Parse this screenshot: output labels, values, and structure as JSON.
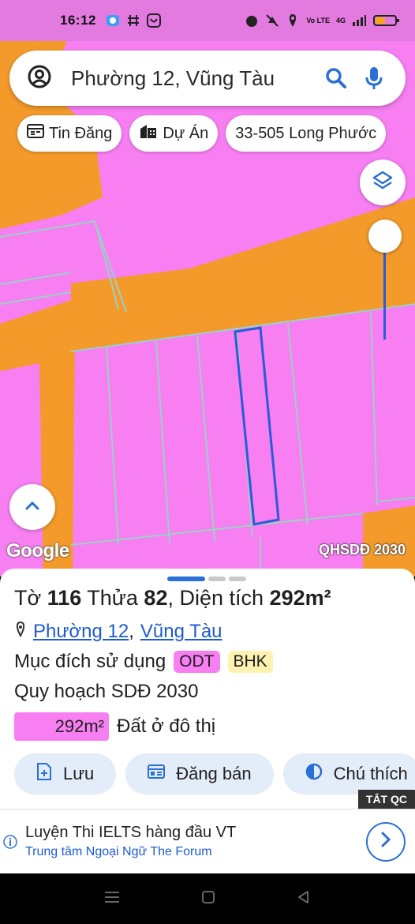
{
  "status_bar": {
    "time": "16:12",
    "network": "4G",
    "volte": "Vo LTE"
  },
  "search": {
    "value": "Phường 12, Vũng Tàu",
    "icons": [
      "account-icon",
      "search-icon",
      "mic-icon"
    ]
  },
  "chips": [
    {
      "label": "Tin Đăng",
      "icon": "listing-icon"
    },
    {
      "label": "Dự Án",
      "icon": "buildings-icon"
    },
    {
      "label": "33-505 Long Phước",
      "icon": ""
    }
  ],
  "map": {
    "attribution": "Google",
    "overlay_tag": "QHSDĐ 2030",
    "colors": {
      "residential": "#f77ff2",
      "road": "#f39a2b",
      "parcel_border": "#9ad0c7",
      "selected_parcel": "#2a5bd7"
    }
  },
  "parcel": {
    "sheet_label": "Tờ",
    "sheet_no": "116",
    "plot_label": "Thửa",
    "plot_no": "82",
    "area_label": "Diện tích",
    "area": "292m²",
    "ward": "Phường 12",
    "city": "Vũng Tàu",
    "purpose_label": "Mục đích sử dụng",
    "purpose_codes": [
      "ODT",
      "BHK"
    ],
    "plan_label": "Quy hoạch SDĐ 2030",
    "plan_area": "292m²",
    "plan_use": "Đất ở đô thị"
  },
  "actions": [
    {
      "label": "Lưu",
      "icon": "save-icon"
    },
    {
      "label": "Đăng bán",
      "icon": "calendar-icon"
    },
    {
      "label": "Chú thích",
      "icon": "contrast-icon"
    }
  ],
  "ad": {
    "tag": "TẮT QC",
    "title": "Luyện Thi IELTS hàng đầu VT",
    "subtitle": "Trung tâm Ngoại Ngữ The Forum"
  }
}
